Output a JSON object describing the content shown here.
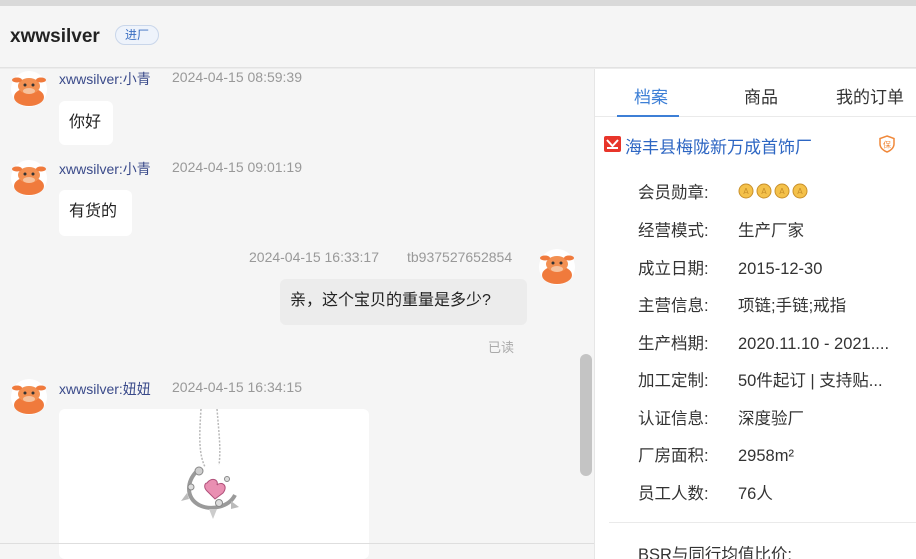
{
  "header": {
    "title": "xwwsilver",
    "badge": "进厂"
  },
  "messages": [
    {
      "sender": "xwwsilver:小青",
      "time": "2024-04-15 08:59:39",
      "text": "你好"
    },
    {
      "sender": "xwwsilver:小青",
      "time": "2024-04-15 09:01:19",
      "text": "有货的"
    },
    {
      "sender": "tb937527652854",
      "time": "2024-04-15 16:33:17",
      "text": "亲，这个宝贝的重量是多少?",
      "status": "已读"
    },
    {
      "sender": "xwwsilver:妞妞",
      "time": "2024-04-15 16:34:15",
      "image": "necklace-photo"
    }
  ],
  "panel": {
    "tabs": [
      "档案",
      "商品",
      "我的订单"
    ],
    "active_tab": "档案",
    "shop_name": "海丰县梅陇新万成首饰厂",
    "rows": [
      {
        "label": "会员勋章:",
        "value": "",
        "medals": 4
      },
      {
        "label": "经营模式:",
        "value": "生产厂家"
      },
      {
        "label": "成立日期:",
        "value": "2015-12-30"
      },
      {
        "label": "主营信息:",
        "value": "项链;手链;戒指"
      },
      {
        "label": "生产档期:",
        "value": "2020.11.10 - 2021...."
      },
      {
        "label": "加工定制:",
        "value": "50件起订 | 支持贴..."
      },
      {
        "label": "认证信息:",
        "value": "深度验厂"
      },
      {
        "label": "厂房面积:",
        "value": "2958m²"
      },
      {
        "label": "员工人数:",
        "value": "76人"
      }
    ],
    "bsr_label": "BSR与同行均值比价:"
  },
  "colors": {
    "accent": "#3d7fd6",
    "shop_link": "#2d66c3",
    "avatar": "#f07a3c"
  },
  "icons": [
    "cow-avatar-icon",
    "shop-logo-icon",
    "shield-icon",
    "medal-icon",
    "double-chevron-right-icon"
  ]
}
